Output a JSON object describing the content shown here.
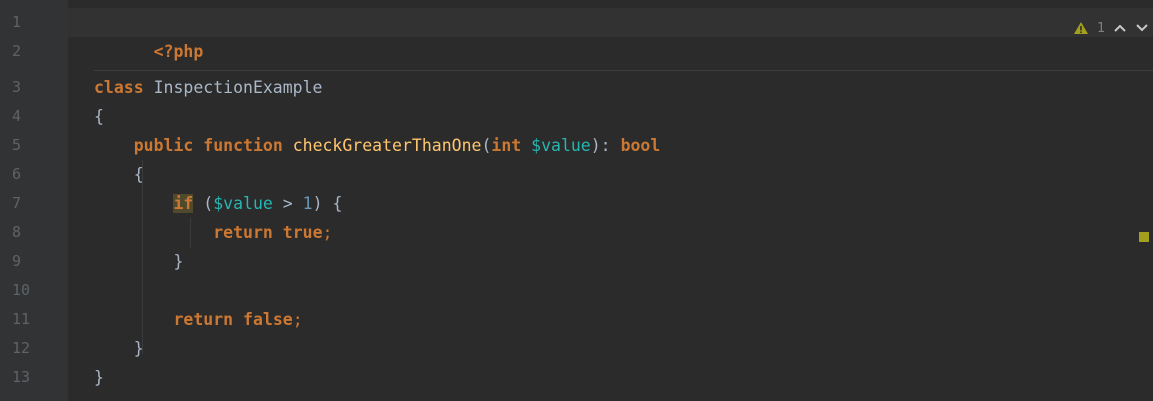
{
  "editor": {
    "line_numbers": [
      "1",
      "2",
      "3",
      "4",
      "5",
      "6",
      "7",
      "8",
      "9",
      "10",
      "11",
      "12",
      "13"
    ],
    "lines": {
      "l1": {
        "open_tag": "<?php"
      },
      "l3": {
        "kw": "class",
        "name": " InspectionExample"
      },
      "l4": {
        "brace": "{"
      },
      "l5": {
        "indent": "    ",
        "kw_public": "public",
        "kw_function": " function",
        "fn_name": " checkGreaterThanOne",
        "paren_open": "(",
        "kw_int": "int",
        "param": " $value",
        "paren_close_colon": "): ",
        "kw_bool": "bool"
      },
      "l6": {
        "indent": "    ",
        "brace": "{"
      },
      "l7": {
        "indent": "        ",
        "kw_if": "if",
        "paren_open": " (",
        "var": "$value",
        "op": " > ",
        "num": "1",
        "rest": ") {"
      },
      "l8": {
        "indent": "            ",
        "kw_return": "return",
        "kw_true": " true",
        "semi": ";"
      },
      "l9": {
        "indent": "        ",
        "brace": "}"
      },
      "l11": {
        "indent": "        ",
        "kw_return": "return",
        "kw_false": " false",
        "semi": ";"
      },
      "l12": {
        "indent": "    ",
        "brace": "}"
      },
      "l13": {
        "brace": "}"
      }
    },
    "inspection": {
      "warning_count": "1",
      "warning_color": "#a3a01e"
    }
  }
}
